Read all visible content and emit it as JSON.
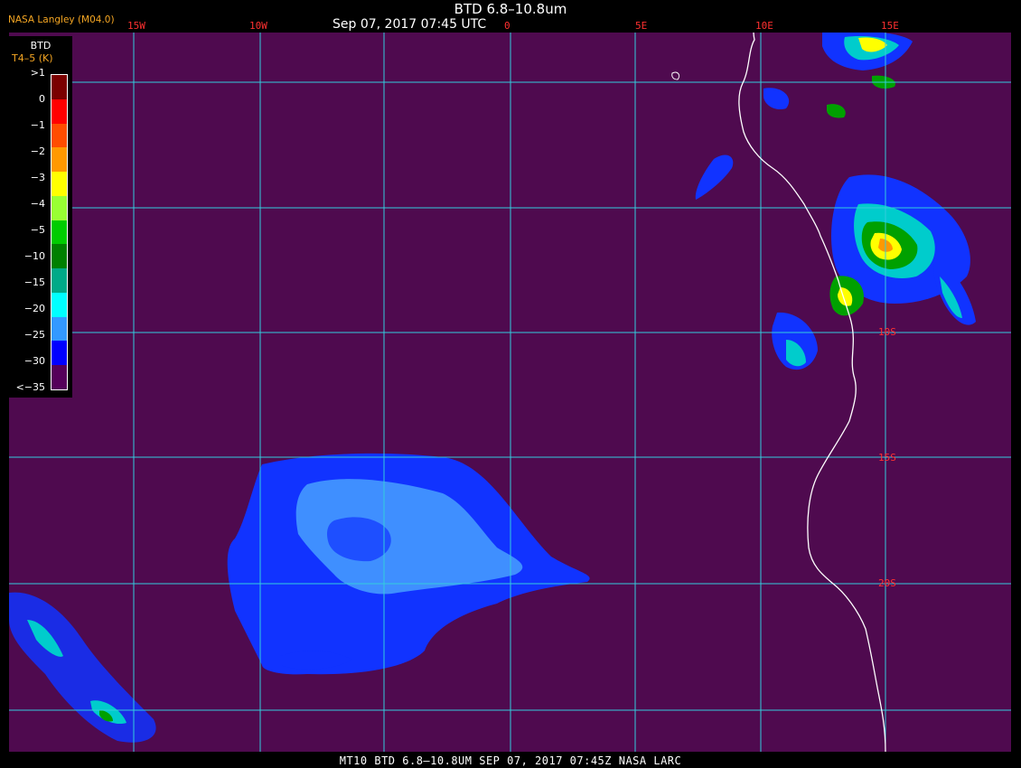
{
  "header": {
    "title": "BTD 6.8–10.8um",
    "date": "Sep 07, 2017 07:45 UTC",
    "provider": "NASA Langley (M04.0)"
  },
  "legend": {
    "title": "BTD",
    "subtitle": "T4–5 (K)",
    "ticks": [
      ">1",
      "0",
      "−1",
      "−2",
      "−3",
      "−4",
      "−5",
      "−10",
      "−15",
      "−20",
      "−25",
      "−30",
      "<−35"
    ],
    "colors": [
      "#7a0000",
      "#ff0000",
      "#ff4d00",
      "#ff9900",
      "#ffff00",
      "#99ff33",
      "#00cc00",
      "#008000",
      "#00aa88",
      "#00ffff",
      "#3399ff",
      "#0000ff",
      "#55005a"
    ]
  },
  "graticule": {
    "lon_labels": [
      "15W",
      "10W",
      "5W",
      "0",
      "5E",
      "10E",
      "15E"
    ],
    "lat_labels": [
      "10S",
      "15S",
      "20S"
    ],
    "color": "#33ccdd"
  },
  "footer": {
    "text": "MT10   BTD 6.8–10.8UM   SEP 07, 2017 07:45Z   NASA LARC"
  },
  "colors": {
    "background": "#4f0a4f",
    "coastline": "#ffffff",
    "label_red": "#ff3030",
    "label_orange": "#f5a623"
  }
}
